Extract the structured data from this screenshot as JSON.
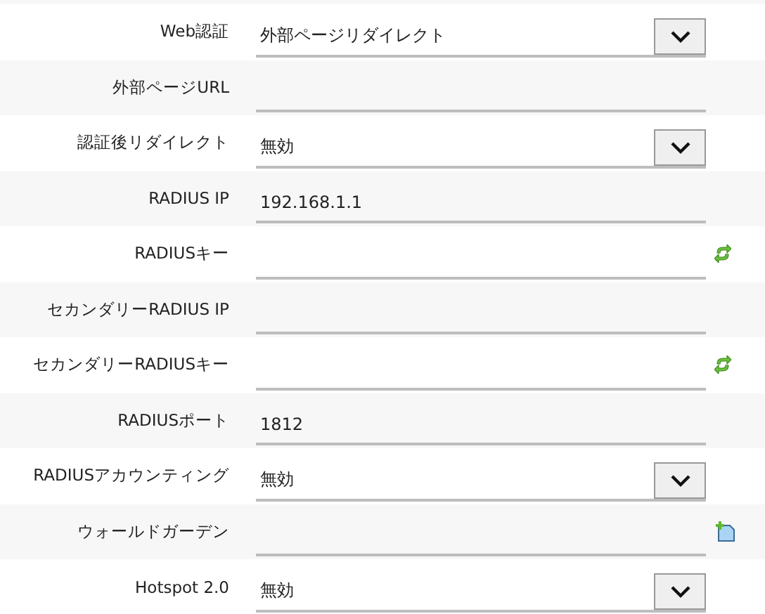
{
  "fields": [
    {
      "label": "Web認証",
      "kind": "select",
      "value": "外部ページリダイレクト"
    },
    {
      "label": "外部ページURL",
      "kind": "text"
    },
    {
      "label": "認証後リダイレクト",
      "kind": "select",
      "value": "無効"
    },
    {
      "label": "RADIUS IP",
      "kind": "text",
      "value": "192.168.1.1"
    },
    {
      "label": "RADIUSキー",
      "kind": "refresh"
    },
    {
      "label": "セカンダリーRADIUS IP",
      "kind": "text"
    },
    {
      "label": "セカンダリーRADIUSキー",
      "kind": "refresh"
    },
    {
      "label": "RADIUSポート",
      "kind": "text",
      "value": "1812"
    },
    {
      "label": "RADIUSアカウンティング",
      "kind": "select",
      "value": "無効"
    },
    {
      "label": "ウォールドガーデン",
      "kind": "add"
    },
    {
      "label": "Hotspot 2.0",
      "kind": "select",
      "value": "無効"
    }
  ]
}
